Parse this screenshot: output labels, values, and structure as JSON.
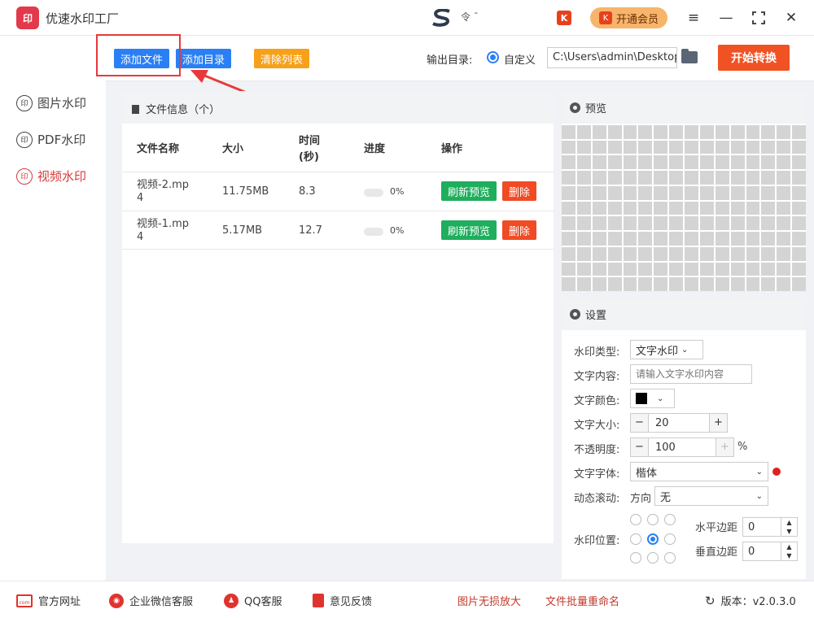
{
  "app": {
    "title": "优速水印工厂",
    "logo_text": "印",
    "mid_text": "令 ¯",
    "vip_label": "开通会员",
    "vip_icon": "K"
  },
  "toolbar": {
    "add_file": "添加文件",
    "add_dir": "添加目录",
    "clear_list": "清除列表",
    "output_label": "输出目录:",
    "radio_label": "自定义",
    "path": "C:\\Users\\admin\\Desktop",
    "start": "开始转换"
  },
  "sidebar": {
    "items": [
      {
        "label": "图片水印"
      },
      {
        "label": "PDF水印"
      },
      {
        "label": "视频水印"
      }
    ]
  },
  "files": {
    "header": "文件信息（个）",
    "columns": [
      "文件名称",
      "大小",
      "时间",
      "(秒)",
      "进度",
      "操作"
    ],
    "rows": [
      {
        "name1": "视频-2.mp",
        "name2": "4",
        "size": "11.75MB",
        "time": "8.3",
        "progress": "0%",
        "preview_btn": "刷新预览",
        "delete_btn": "删除"
      },
      {
        "name1": "视频-1.mp",
        "name2": "4",
        "size": "5.17MB",
        "time": "12.7",
        "progress": "0%",
        "preview_btn": "刷新预览",
        "delete_btn": "删除"
      }
    ]
  },
  "preview": {
    "title": "预览"
  },
  "settings": {
    "title": "设置",
    "type_label": "水印类型:",
    "type_value": "文字水印",
    "content_label": "文字内容:",
    "content_placeholder": "请输入文字水印内容",
    "color_label": "文字颜色:",
    "size_label": "文字大小:",
    "size_value": "20",
    "opacity_label": "不透明度:",
    "opacity_value": "100",
    "opacity_unit": "%",
    "font_label": "文字字体:",
    "font_value": "楷体",
    "scroll_label": "动态滚动:",
    "scroll_dir": "方向",
    "scroll_value": "无",
    "pos_label": "水印位置:",
    "hmargin_label": "水平边距",
    "hmargin_value": "0",
    "vmargin_label": "垂直边距",
    "vmargin_value": "0",
    "minus": "−",
    "plus": "+"
  },
  "footer": {
    "site": "官方网址",
    "wechat": "企业微信客服",
    "qq": "QQ客服",
    "feedback": "意见反馈",
    "upscale": "图片无损放大",
    "rename": "文件批量重命名",
    "version": "版本：v2.0.3.0"
  },
  "colors": {
    "primary": "#2a7ff5",
    "orange": "#f7a11a",
    "green": "#1eae5d",
    "red": "#f04b24",
    "start": "#f15223",
    "accent": "#d83b3b",
    "highlight": "#e8393a"
  }
}
